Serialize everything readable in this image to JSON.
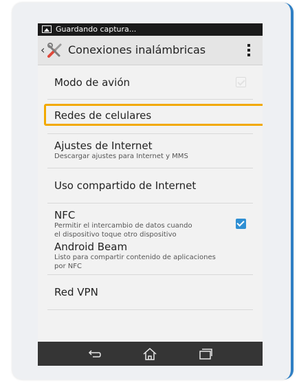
{
  "status_bar": {
    "text": "Guardando captura..."
  },
  "action_bar": {
    "title": "Conexiones inalámbricas"
  },
  "settings": [
    {
      "title": "Modo de avión",
      "subtitle": "",
      "checkbox": "disabled"
    },
    {
      "title": "Redes de celulares",
      "subtitle": "",
      "checkbox": "none",
      "highlighted": true
    },
    {
      "title": "Ajustes de Internet",
      "subtitle": "Descargar ajustes para Internet y MMS",
      "checkbox": "none"
    },
    {
      "title": "Uso compartido de Internet",
      "subtitle": "",
      "checkbox": "none"
    },
    {
      "title": "NFC",
      "subtitle_lines": [
        "Permitir el intercambio de datos cuando",
        "el dispositivo toque otro dispositivo"
      ],
      "checkbox": "checked"
    },
    {
      "title": "Android Beam",
      "subtitle_lines": [
        "Listo para compartir contenido de aplicaciones",
        "por NFC"
      ],
      "checkbox": "none"
    },
    {
      "title": "Red VPN",
      "subtitle": "",
      "checkbox": "none"
    }
  ],
  "icons": {
    "status": "image-icon",
    "back": "chevron-left-icon",
    "app": "tools-icon",
    "overflow": "overflow-menu-icon",
    "nav_back": "back-icon",
    "nav_home": "home-icon",
    "nav_recents": "recent-apps-icon"
  },
  "colors": {
    "highlight": "#f2a900",
    "checkbox_checked": "#2f8fd3",
    "card_border": "#2f7fc4"
  }
}
